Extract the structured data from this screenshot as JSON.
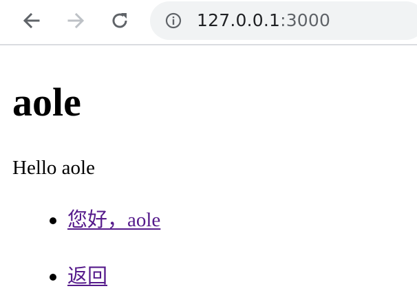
{
  "browser": {
    "url_host": "127.0.0.1",
    "url_port": ":3000",
    "icons": {
      "back": "back-arrow-icon",
      "forward": "forward-arrow-icon",
      "reload": "reload-icon",
      "info": "info-icon"
    },
    "colors": {
      "omnibox_bg": "#f1f3f4",
      "icon_active": "#5f6368",
      "icon_disabled": "#bdc1c6"
    }
  },
  "page": {
    "heading": "aole",
    "paragraph": "Hello aole",
    "links": [
      {
        "label": "您好，aole"
      },
      {
        "label": "返回"
      }
    ],
    "link_color": "#551a8b"
  }
}
